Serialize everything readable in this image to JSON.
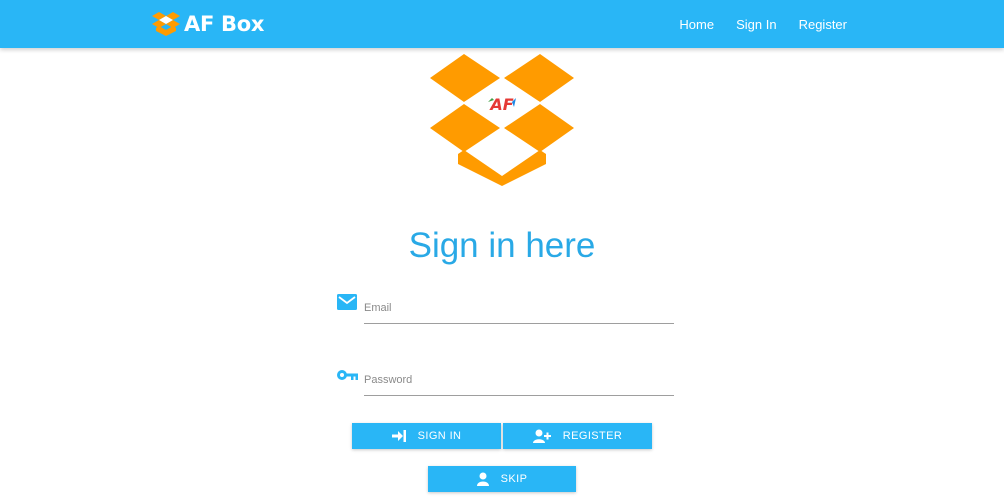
{
  "navbar": {
    "brand": "AF Box",
    "links": [
      "Home",
      "Sign In",
      "Register"
    ]
  },
  "hero": {
    "logo_text": "AF"
  },
  "page": {
    "heading": "Sign in here"
  },
  "form": {
    "email_placeholder": "Email",
    "password_placeholder": "Password"
  },
  "buttons": {
    "signin": "SIGN IN",
    "register": "REGISTER",
    "skip": "SKIP"
  },
  "icons": {
    "brand": "box-logo-icon",
    "email": "mail-icon",
    "password": "key-icon",
    "signin": "login-icon",
    "register": "add-user-icon",
    "skip": "user-icon"
  },
  "colors": {
    "primary": "#29b6f6",
    "heading": "#29a9e6",
    "logo_orange": "#ff9b00"
  }
}
